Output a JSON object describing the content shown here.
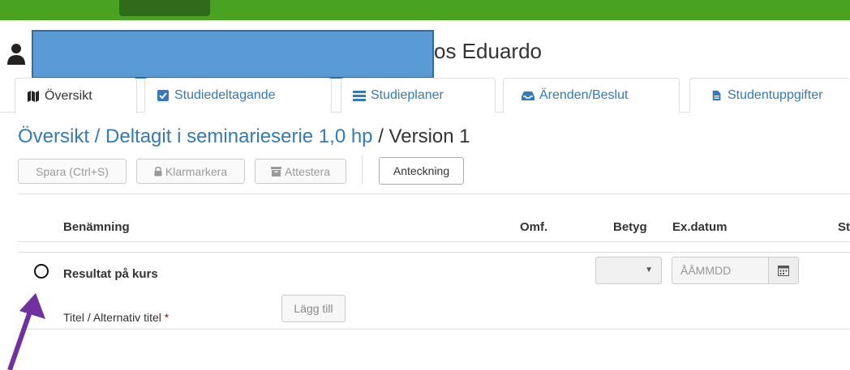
{
  "user": {
    "name": "os Eduardo"
  },
  "tabs": [
    {
      "label": "Översikt",
      "icon": "map-icon",
      "active": true
    },
    {
      "label": "Studiedeltagande",
      "icon": "checkbox-icon",
      "active": false
    },
    {
      "label": "Studieplaner",
      "icon": "list-icon",
      "active": false
    },
    {
      "label": "Ärenden/Beslut",
      "icon": "inbox-icon",
      "active": false
    },
    {
      "label": "Studentuppgifter",
      "icon": "file-icon",
      "active": false
    }
  ],
  "breadcrumb": {
    "root": "Översikt",
    "sep1": " / ",
    "item": "Deltagit i seminarieserie 1,0 hp",
    "sep2": " / ",
    "current": "Version 1"
  },
  "toolbar": {
    "save_label": "Spara (Ctrl+S)",
    "mark_label": "Klarmarkera",
    "attest_label": "Attestera",
    "note_label": "Anteckning"
  },
  "table": {
    "columns": [
      "Benämning",
      "Omf.",
      "Betyg",
      "Ex.datum",
      "St"
    ],
    "row": {
      "title": "Resultat på kurs",
      "date_placeholder": "ÅÅMMDD",
      "sub_label": "Titel / Alternativ titel",
      "required_mark": "*",
      "add_label": "Lägg till"
    }
  },
  "colors": {
    "topbar": "#4aa320",
    "link": "#337ab7",
    "annotation_arrow": "#7030a0"
  }
}
